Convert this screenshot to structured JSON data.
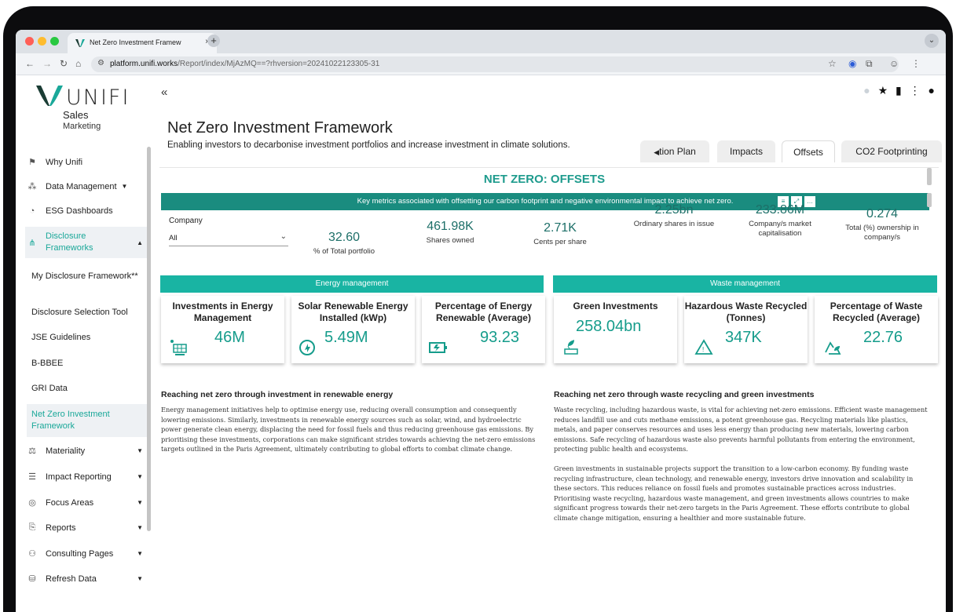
{
  "browser": {
    "tab_title": "Net Zero Investment Framew",
    "tab_close": "×",
    "new_tab": "+",
    "url_site": "platform.unifi.works",
    "url_path": "/Report/index/MjAzMQ==?rhversion=20241022123305-31"
  },
  "sidebar": {
    "logo_text": "UNIFI",
    "role_title": "Sales",
    "role_subtitle": "Marketing",
    "items": [
      {
        "label": "Why Unifi",
        "icon": "sign-icon"
      },
      {
        "label": "Data Management",
        "icon": "network-icon",
        "has_caret": true
      },
      {
        "label": "ESG Dashboards",
        "icon": "pie-icon"
      },
      {
        "label": "Disclosure Frameworks",
        "icon": "hierarchy-icon",
        "has_caret": true,
        "expanded": true
      },
      {
        "label": "Materiality",
        "icon": "scale-icon",
        "has_caret": true
      },
      {
        "label": "Impact Reporting",
        "icon": "list-icon",
        "has_caret": true
      },
      {
        "label": "Focus Areas",
        "icon": "target-icon",
        "has_caret": true
      },
      {
        "label": "Reports",
        "icon": "report-icon",
        "has_caret": true
      },
      {
        "label": "Consulting Pages",
        "icon": "handshake-icon",
        "has_caret": true
      },
      {
        "label": "Refresh Data",
        "icon": "database-icon",
        "has_caret": true
      }
    ],
    "subitems": [
      "My Disclosure Framework**",
      "Disclosure Selection Tool",
      "JSE Guidelines",
      "B-BBEE",
      "GRI Data",
      "Net Zero Investment Framework"
    ]
  },
  "header": {
    "collapse_label": "«",
    "title": "Net Zero Investment Framework",
    "subtitle": "Enabling investors to decarbonise investment portfolios and increase investment in climate solutions."
  },
  "tabs": [
    {
      "label": "tion Plan"
    },
    {
      "label": "Impacts"
    },
    {
      "label": "Offsets",
      "active": true
    },
    {
      "label": "CO2 Footprinting"
    }
  ],
  "report": {
    "title": "NET ZERO: OFFSETS",
    "banner": "Key metrics associated with offsetting our carbon footprint and negative environmental impact to achieve net zero.",
    "company_label": "Company",
    "company_value": "All",
    "kpis": [
      {
        "value": "32.60",
        "label": "% of Total portfolio"
      },
      {
        "value": "461.98K",
        "label": "Shares owned"
      },
      {
        "value": "2.71K",
        "label": "Cents per share"
      },
      {
        "value": "2.25bn",
        "label": "Ordinary shares in issue"
      },
      {
        "value": "233.86M",
        "label": "Company/s market capitalisation"
      },
      {
        "value": "0.274",
        "label": "Total (%) ownership in company/s"
      }
    ],
    "energy_header": "Energy management",
    "waste_header": "Waste management",
    "cards": [
      {
        "title": "Investments in Energy Management",
        "value": "46M",
        "icon": "solar-panel-icon"
      },
      {
        "title": "Solar Renewable Energy Installed (kWp)",
        "value": "5.49M",
        "icon": "eco-energy-icon"
      },
      {
        "title": "Percentage of Energy Renewable (Average)",
        "value": "93.23",
        "icon": "battery-icon"
      },
      {
        "title": "Green Investments",
        "value": "258.04bn",
        "icon": "green-investment-icon"
      },
      {
        "title": "Hazardous Waste Recycled (Tonnes)",
        "value": "347K",
        "icon": "hazard-recycle-icon"
      },
      {
        "title": "Percentage of Waste Recycled (Average)",
        "value": "22.76",
        "icon": "recycle-leaf-icon"
      }
    ],
    "left_heading": "Reaching net zero through investment in renewable energy",
    "left_text": "Energy management initiatives help to optimise energy use, reducing overall consumption and consequently lowering emissions. Similarly, investments in renewable energy sources such as solar, wind, and hydroelectric power generate clean energy, displacing the need for fossil fuels and thus reducing greenhouse gas emissions. By prioritising these investments, corporations can make significant strides towards achieving the net-zero emissions targets outlined in the Paris Agreement, ultimately contributing to global efforts to combat climate change.",
    "right_heading": "Reaching net zero through waste recycling and green investments",
    "right_text_1": "Waste recycling, including hazardous waste, is vital for achieving net-zero emissions. Efficient waste management reduces landfill use and cuts methane emissions, a potent greenhouse gas. Recycling materials like plastics, metals, and paper conserves resources and uses less energy than producing new materials, lowering carbon emissions. Safe recycling of hazardous waste also prevents harmful pollutants from entering the environment, protecting public health and ecosystems.",
    "right_text_2": "Green investments in sustainable projects support the transition to a low-carbon economy. By funding waste recycling infrastructure, clean technology, and renewable energy, investors drive innovation and scalability in these sectors. This reduces reliance on fossil fuels and promotes sustainable practices across industries. Prioritising waste recycling, hazardous waste management, and green investments allows countries to make significant progress towards their net-zero targets in the Paris Agreement. These efforts contribute to global climate change mitigation, ensuring a healthier and more sustainable future."
  },
  "colors": {
    "accent": "#19b4a3",
    "banner": "#1a8c7f",
    "value": "#159c8b",
    "title_teal": "#1e9b8d"
  }
}
